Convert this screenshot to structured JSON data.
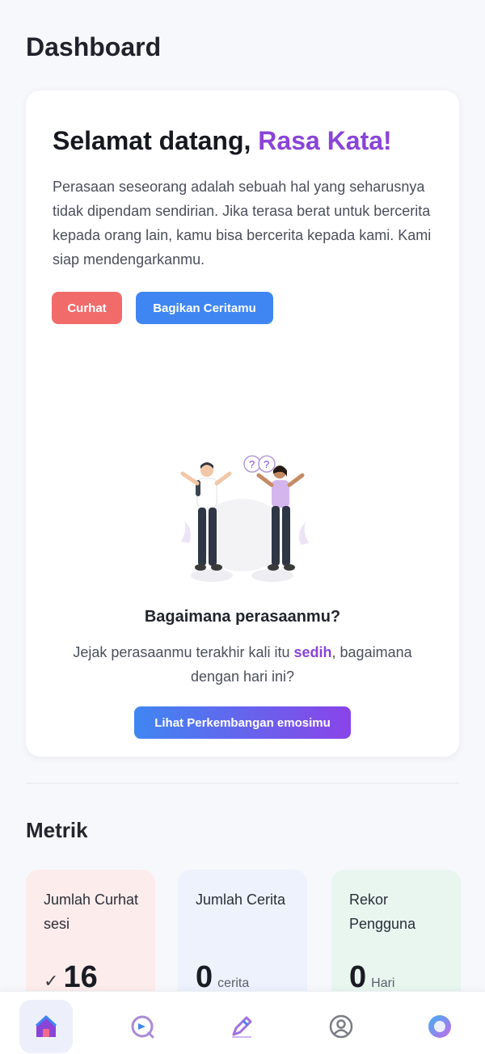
{
  "header": {
    "title": "Dashboard"
  },
  "welcome": {
    "greeting": "Selamat datang, ",
    "name": "Rasa Kata!",
    "description": "Perasaan seseorang adalah sebuah hal yang seharusnya tidak dipendam sendirian. Jika terasa berat untuk bercerita kepada orang lain, kamu bisa bercerita kepada kami. Kami siap mendengarkanmu.",
    "curhat_button": "Curhat",
    "share_button": "Bagikan Ceritamu"
  },
  "feeling": {
    "title": "Bagaimana perasaanmu?",
    "desc_before": "Jejak perasaanmu terakhir kali itu ",
    "emotion": "sedih",
    "desc_after": ", bagaimana dengan hari ini?",
    "button": "Lihat Perkembangan emosimu"
  },
  "metrics": {
    "title": "Metrik",
    "items": [
      {
        "label": "Jumlah Curhat sesi",
        "prefix": "✓",
        "value": "16",
        "unit": ""
      },
      {
        "label": "Jumlah Cerita",
        "prefix": "",
        "value": "0",
        "unit": "cerita"
      },
      {
        "label": "Rekor Pengguna",
        "prefix": "",
        "value": "0",
        "unit": "Hari"
      }
    ]
  },
  "nav": {
    "items": [
      {
        "icon": "home-icon",
        "active": true
      },
      {
        "icon": "chat-icon",
        "active": false
      },
      {
        "icon": "pencil-icon",
        "active": false
      },
      {
        "icon": "profile-icon",
        "active": false
      },
      {
        "icon": "avatar-icon",
        "active": false
      }
    ]
  },
  "colors": {
    "accent_purple": "#8a44d8",
    "curhat_red": "#f26b6b",
    "share_blue": "#3f86f2"
  }
}
